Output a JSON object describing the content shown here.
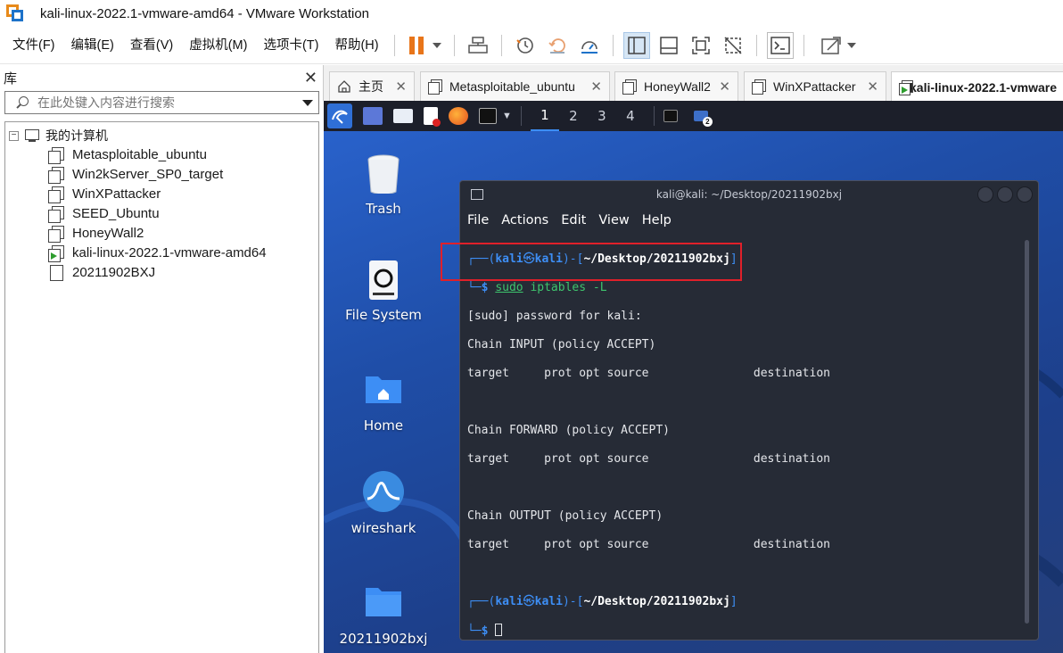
{
  "window": {
    "title": "kali-linux-2022.1-vmware-amd64 - VMware Workstation"
  },
  "menubar": {
    "items": [
      "文件(F)",
      "编辑(E)",
      "查看(V)",
      "虚拟机(M)",
      "选项卡(T)",
      "帮助(H)"
    ]
  },
  "library": {
    "title": "库",
    "search_placeholder": "在此处键入内容进行搜索",
    "root_label": "我的计算机",
    "items": [
      {
        "label": "Metasploitable_ubuntu",
        "icon": "vm-icon"
      },
      {
        "label": "Win2kServer_SP0_target",
        "icon": "vm-icon"
      },
      {
        "label": "WinXPattacker",
        "icon": "vm-icon"
      },
      {
        "label": "SEED_Ubuntu",
        "icon": "vm-icon"
      },
      {
        "label": "HoneyWall2",
        "icon": "vm-icon"
      },
      {
        "label": "kali-linux-2022.1-vmware-amd64",
        "icon": "vm-running-icon"
      },
      {
        "label": "20211902BXJ",
        "icon": "document-icon"
      }
    ]
  },
  "tabs": [
    {
      "label": "主页",
      "icon": "home-icon"
    },
    {
      "label": "Metasploitable_ubuntu",
      "icon": "vm-icon"
    },
    {
      "label": "HoneyWall2",
      "icon": "vm-icon"
    },
    {
      "label": "WinXPattacker",
      "icon": "vm-icon"
    },
    {
      "label": "kali-linux-2022.1-vmware",
      "icon": "vm-running-icon",
      "active": true
    }
  ],
  "guest": {
    "workspaces": [
      "1",
      "2",
      "3",
      "4"
    ],
    "active_workspace": "1",
    "desktop_icons": [
      {
        "label": "Trash",
        "icon": "trash-icon"
      },
      {
        "label": "File System",
        "icon": "drive-icon"
      },
      {
        "label": "Home",
        "icon": "home-folder-icon"
      },
      {
        "label": "wireshark",
        "icon": "wireshark-icon"
      },
      {
        "label": "20211902bxj",
        "icon": "folder-icon"
      }
    ],
    "terminal": {
      "title": "kali@kali: ~/Desktop/20211902bxj",
      "menu": [
        "File",
        "Actions",
        "Edit",
        "View",
        "Help"
      ],
      "prompt_user": "kali",
      "prompt_at": "㉿",
      "prompt_host": "kali",
      "prompt_path": "~/Desktop/20211902bxj",
      "command_sudo": "sudo",
      "command_rest": " iptables -L",
      "output": [
        "[sudo] password for kali:",
        "Chain INPUT (policy ACCEPT)",
        "target     prot opt source               destination",
        "",
        "Chain FORWARD (policy ACCEPT)",
        "target     prot opt source               destination",
        "",
        "Chain OUTPUT (policy ACCEPT)",
        "target     prot opt source               destination"
      ]
    }
  },
  "colors": {
    "highlight_box": "#e0202a",
    "prompt_blue": "#3d8ef5",
    "command_green": "#3ec46d",
    "pause_orange": "#e8751a"
  }
}
